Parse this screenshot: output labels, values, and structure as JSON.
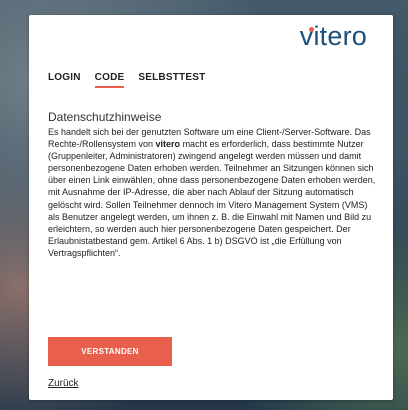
{
  "logo": {
    "text": "vitero"
  },
  "tabs": [
    {
      "label": "LOGIN"
    },
    {
      "label": "CODE"
    },
    {
      "label": "SELBSTTEST"
    }
  ],
  "privacy": {
    "title": "Datenschutzhinweise",
    "text_before_bold": "Es handelt sich bei der genutzten Software um eine Client-/Server-Software. Das Rechte-/Rollensystem von ",
    "bold": "vitero",
    "text_after_bold": " macht es erforderlich, dass bestimmte Nutzer (Gruppenleiter, Administratoren) zwingend angelegt werden müssen und damit personenbezogene Daten erhoben werden. Teilnehmer an Sitzungen können sich über einen Link einwählen, ohne dass personenbezogene Daten erhoben werden, mit Ausnahme der IP-Adresse, die aber nach Ablauf der Sitzung automatisch gelöscht wird. Sollen Teilnehmer dennoch im Vitero Management System (VMS) als Benutzer angelegt werden, um ihnen z. B. die Einwahl mit Namen und Bild zu erleichtern, so werden auch hier personenbezogene Daten gespeichert. Der Erlaubnistatbestand gem. Artikel 6 Abs. 1 b) DSGVO ist „die Erfüllung von Vertragspflichten“."
  },
  "buttons": {
    "accept_label": "VERSTANDEN"
  },
  "links": {
    "back_label": "Zurück"
  },
  "colors": {
    "accent": "#e8604c",
    "logo": "#1f4e79"
  }
}
